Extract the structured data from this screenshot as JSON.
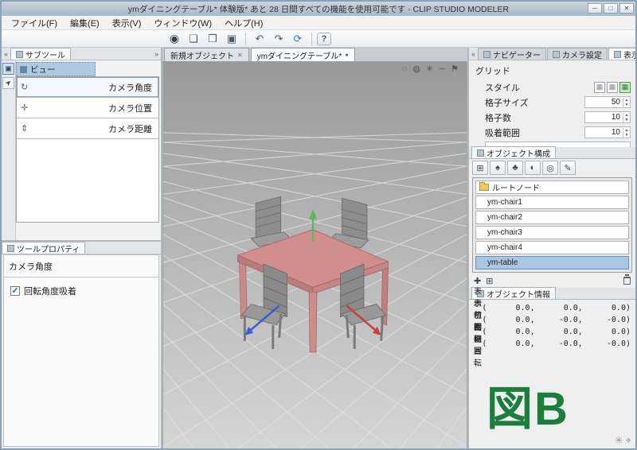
{
  "window": {
    "title": "ymダイニングテーブル* 体験版* あと 28 日間すべての機能を使用可能です - CLIP STUDIO MODELER",
    "buttons": {
      "minimize": "─",
      "maximize": "□",
      "close": "✕"
    }
  },
  "menubar": {
    "items": [
      "ファイル(F)",
      "編集(E)",
      "表示(V)",
      "ウィンドウ(W)",
      "ヘルプ(H)"
    ]
  },
  "toolbar": {
    "icons": {
      "logo": "◉",
      "new": "❏",
      "open": "❒",
      "save": "▣",
      "undo": "↶",
      "redo": "↷",
      "sync": "⟳",
      "help": "?"
    }
  },
  "left": {
    "collapse": "«",
    "expand": "»",
    "tab": "サブツール",
    "strip_icons": [
      "▣",
      "➤"
    ],
    "group": "ビュー",
    "items": [
      "カメラ角度",
      "カメラ位置",
      "カメラ距離"
    ],
    "item_icons": [
      "↻",
      "✛",
      "⇕"
    ],
    "prop_tab": "ツールプロパティ",
    "prop_title": "カメラ角度",
    "checkbox_label": "回転角度吸着",
    "check_glyph": "✓"
  },
  "docs": {
    "tabs": [
      {
        "label": "新規オブジェクト",
        "close": "✕"
      },
      {
        "label": "ymダイニングテーブル*",
        "dot": "●"
      }
    ]
  },
  "viewport": {
    "icons": [
      "◌",
      "◍",
      "✳",
      "─",
      "⚑"
    ]
  },
  "right": {
    "collapse": "«",
    "tabs": [
      "ナビゲーター",
      "カメラ設定",
      "表示設定"
    ],
    "grid": {
      "title": "グリッド",
      "style_label": "スタイル",
      "style_glyph": "▦",
      "rows": [
        {
          "label": "格子サイズ",
          "value": "50"
        },
        {
          "label": "格子数",
          "value": "10"
        },
        {
          "label": "吸着範囲",
          "value": "10"
        }
      ],
      "spin_up": "▲",
      "spin_down": "▼"
    },
    "tree": {
      "tab": "オブジェクト構成",
      "toolbar": [
        "⊞",
        "♠",
        "♣",
        "◐",
        "◎",
        "✎"
      ],
      "root": "ルートノード",
      "items": [
        "ym-chair1",
        "ym-chair2",
        "ym-chair3",
        "ym-chair4",
        "ym-table"
      ],
      "add": "✚",
      "add_folder": "⊞"
    },
    "info": {
      "tab": "オブジェクト情報",
      "rows": [
        {
          "label": "表示位置",
          "values": "(      0.0,      0.0,      0.0)"
        },
        {
          "label": "表示回転",
          "values": "(      0.0,     -0.0,     -0.0)"
        },
        {
          "label": "初期位置",
          "values": "(      0.0,      0.0,      0.0)"
        },
        {
          "label": "初期回転",
          "values": "(      0.0,     -0.0,     -0.0)"
        }
      ]
    },
    "corner_icons": [
      "✳",
      "⌖"
    ]
  },
  "annotation": {
    "text": "図B",
    "color": "#1d7d3c"
  },
  "colors": {
    "selection": "#a9c7e2",
    "table": "#d28e8e",
    "chair": "#8d8d8d",
    "axis_x": "#c94040",
    "axis_y": "#5cb85c",
    "axis_z": "#3a5fd0"
  }
}
